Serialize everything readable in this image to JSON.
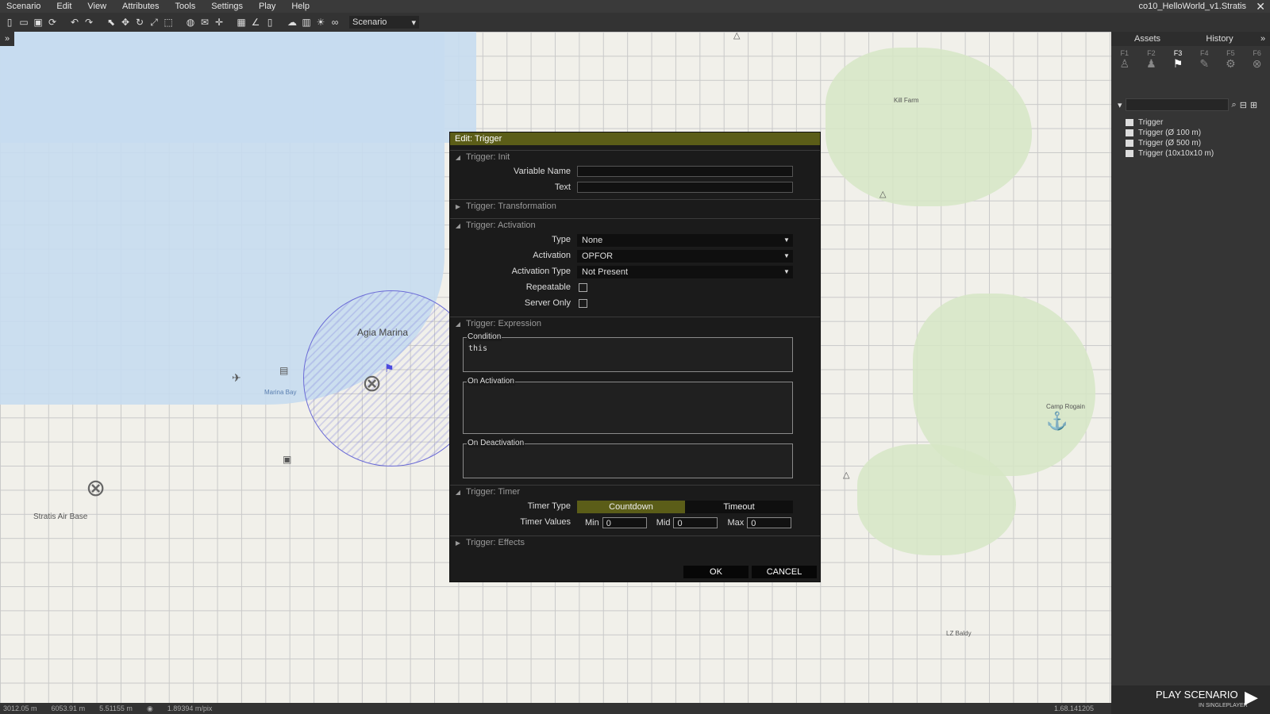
{
  "menubar": {
    "items": [
      "Scenario",
      "Edit",
      "View",
      "Attributes",
      "Tools",
      "Settings",
      "Play",
      "Help"
    ],
    "window_title": "co10_HelloWorld_v1.Stratis"
  },
  "toolbar": {
    "mode_value": "Scenario"
  },
  "map": {
    "labels": {
      "agia_marina": "Agia Marina",
      "marina_bay": "Marina Bay",
      "kill_farm": "Kill Farm",
      "camp_rogain": "Camp Rogain",
      "stratis_air_base": "Stratis Air Base",
      "lz_baldy": "LZ Baldy"
    }
  },
  "statusbar": {
    "x": "3012.05 m",
    "y": "6053.91 m",
    "z": "5.51155 m",
    "ratio": "1.89394 m/pix",
    "right": "1.68.141205"
  },
  "right_panel": {
    "tabs": [
      "Assets",
      "History"
    ],
    "fkeys": [
      "F1",
      "F2",
      "F3",
      "F4",
      "F5",
      "F6"
    ],
    "active_fkey": "F3",
    "list": [
      "Trigger",
      "Trigger (Ø 100 m)",
      "Trigger (Ø 500 m)",
      "Trigger (10x10x10 m)"
    ]
  },
  "play": {
    "label": "PLAY SCENARIO",
    "sub": "IN SINGLEPLAYER"
  },
  "dialog": {
    "title": "Edit: Trigger",
    "sections": {
      "init": "Trigger: Init",
      "transformation": "Trigger: Transformation",
      "activation": "Trigger: Activation",
      "expression": "Trigger: Expression",
      "timer": "Trigger: Timer",
      "effects": "Trigger: Effects"
    },
    "init": {
      "variable_name_label": "Variable Name",
      "variable_name_value": "",
      "text_label": "Text",
      "text_value": ""
    },
    "activation": {
      "type_label": "Type",
      "type_value": "None",
      "activation_label": "Activation",
      "activation_value": "OPFOR",
      "activation_type_label": "Activation Type",
      "activation_type_value": "Not Present",
      "repeatable_label": "Repeatable",
      "server_only_label": "Server Only"
    },
    "expression": {
      "condition_label": "Condition",
      "condition_value": "this",
      "on_activation_label": "On Activation",
      "on_activation_value": "",
      "on_deactivation_label": "On Deactivation",
      "on_deactivation_value": ""
    },
    "timer": {
      "timer_type_label": "Timer Type",
      "countdown": "Countdown",
      "timeout": "Timeout",
      "timer_values_label": "Timer Values",
      "min_label": "Min",
      "min_value": "0",
      "mid_label": "Mid",
      "mid_value": "0",
      "max_label": "Max",
      "max_value": "0"
    },
    "ok": "OK",
    "cancel": "CANCEL"
  }
}
